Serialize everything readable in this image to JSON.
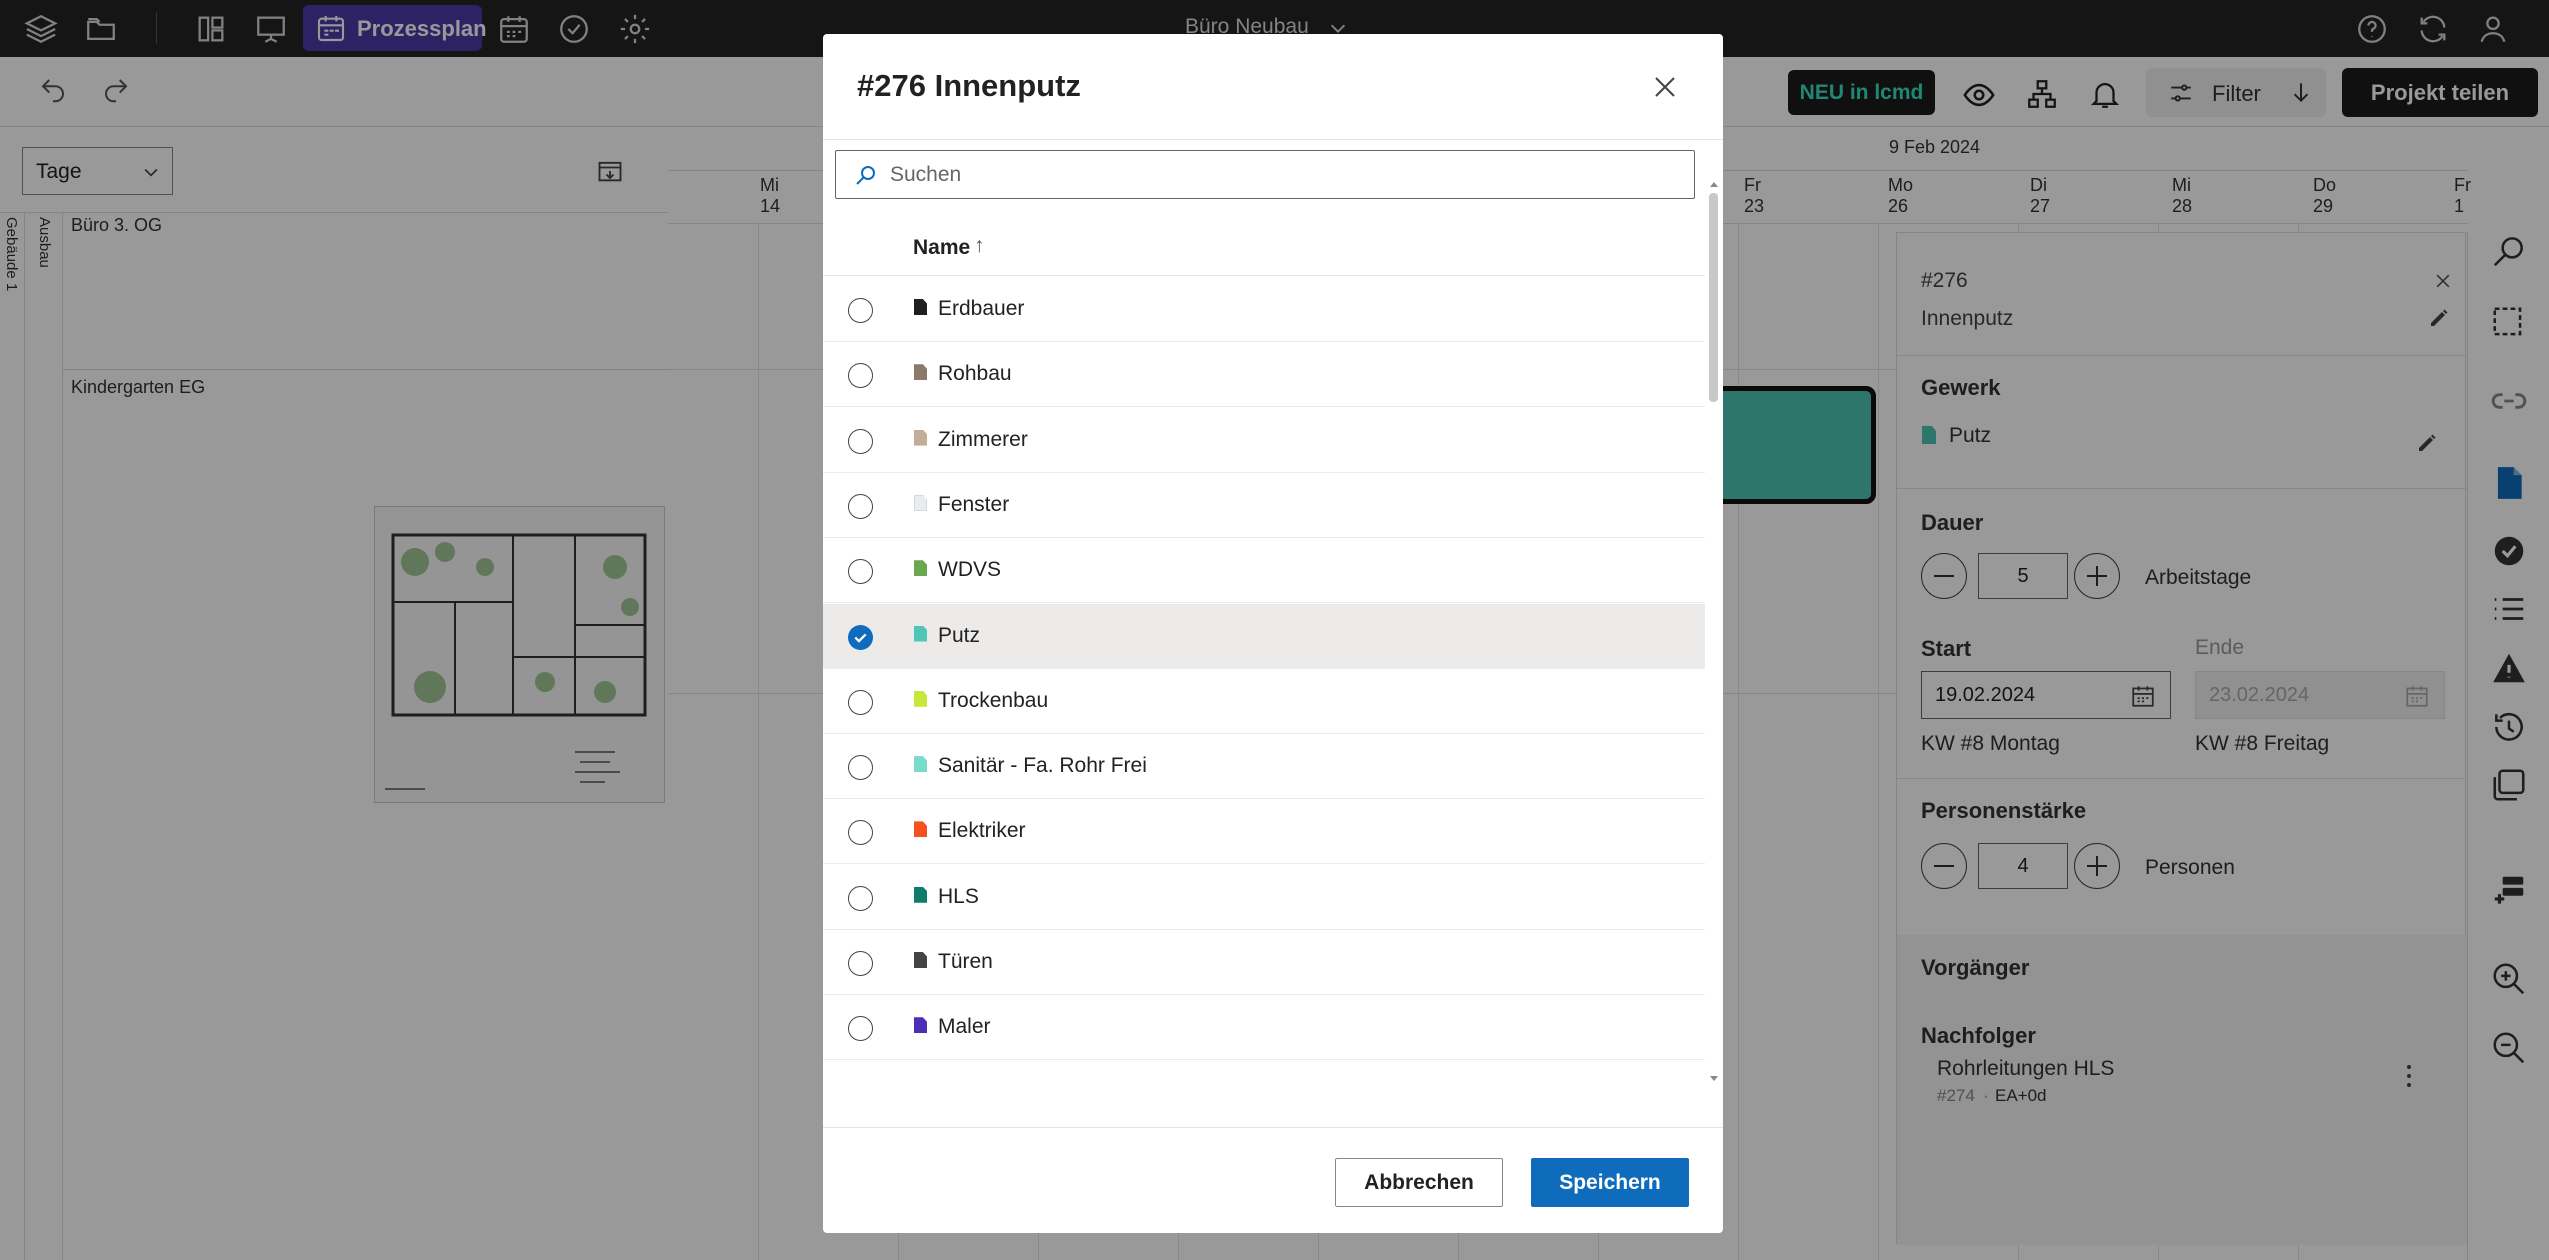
{
  "topbar": {
    "active_view": "Prozessplan",
    "project_title": "Büro Neubau",
    "icons": [
      "layers-icon",
      "folder-icon",
      "grid-icon",
      "presentation-icon",
      "calendar-icon",
      "calendar-grid-icon",
      "check-circle-icon",
      "gear-icon",
      "help-icon",
      "refresh-icon",
      "user-icon"
    ]
  },
  "toolbar": {
    "new_badge": "NEU in lcmd",
    "filter_label": "Filter",
    "share_label": "Projekt teilen"
  },
  "left_panel": {
    "view_select": "Tage",
    "vertical_labels": [
      "Gebäude 1",
      "Ausbau"
    ],
    "rows": [
      "Büro 3. OG",
      "Kindergarten EG"
    ]
  },
  "timeline": {
    "month_label": "9 Feb 2024",
    "days": [
      {
        "weekday": "Mi",
        "day": "14"
      },
      {
        "weekday": "Fr",
        "day": "23"
      },
      {
        "weekday": "Mo",
        "day": "26"
      },
      {
        "weekday": "Di",
        "day": "27"
      },
      {
        "weekday": "Mi",
        "day": "28"
      },
      {
        "weekday": "Do",
        "day": "29"
      },
      {
        "weekday": "Fr",
        "day": "1"
      }
    ]
  },
  "detail": {
    "id": "#276",
    "name": "Innenputz",
    "gewerk_title": "Gewerk",
    "gewerk_value": "Putz",
    "dauer_title": "Dauer",
    "dauer_value": "5",
    "dauer_unit": "Arbeitstage",
    "start_title": "Start",
    "start_value": "19.02.2024",
    "start_kw": "KW #8 Montag",
    "ende_title": "Ende",
    "ende_value": "23.02.2024",
    "ende_kw": "KW #8 Freitag",
    "personen_title": "Personenstärke",
    "personen_value": "4",
    "personen_unit": "Personen",
    "vorgaenger_title": "Vorgänger",
    "nachfolger_title": "Nachfolger",
    "nachfolger_name": "Rohrleitungen HLS",
    "nachfolger_id": "#274",
    "nachfolger_rel": "EA+0d"
  },
  "modal": {
    "title": "#276 Innenputz",
    "search_placeholder": "Suchen",
    "column_header": "Name",
    "sort_indicator": "↑",
    "items": [
      {
        "name": "Erdbauer",
        "color": "#1f1f1f",
        "selected": false
      },
      {
        "name": "Rohbau",
        "color": "#8b7a6a",
        "selected": false
      },
      {
        "name": "Zimmerer",
        "color": "#c4ad96",
        "selected": false
      },
      {
        "name": "Fenster",
        "color": "#e9edf2",
        "selected": false
      },
      {
        "name": "WDVS",
        "color": "#6aa84f",
        "selected": false
      },
      {
        "name": "Putz",
        "color": "#4ec5b5",
        "selected": true
      },
      {
        "name": "Trockenbau",
        "color": "#c5e83a",
        "selected": false
      },
      {
        "name": "Sanitär - Fa. Rohr Frei",
        "color": "#76dccb",
        "selected": false
      },
      {
        "name": "Elektriker",
        "color": "#f4511e",
        "selected": false
      },
      {
        "name": "HLS",
        "color": "#0f7b6c",
        "selected": false
      },
      {
        "name": "Türen",
        "color": "#444444",
        "selected": false
      },
      {
        "name": "Maler",
        "color": "#4b2fb5",
        "selected": false
      }
    ],
    "cancel_label": "Abbrechen",
    "save_label": "Speichern"
  },
  "colors": {
    "accent": "#0f6cbd",
    "active_view_bg": "#4b3aa6",
    "new_badge_text": "#3ae0c2",
    "task_bar": "#4ec5b5"
  }
}
